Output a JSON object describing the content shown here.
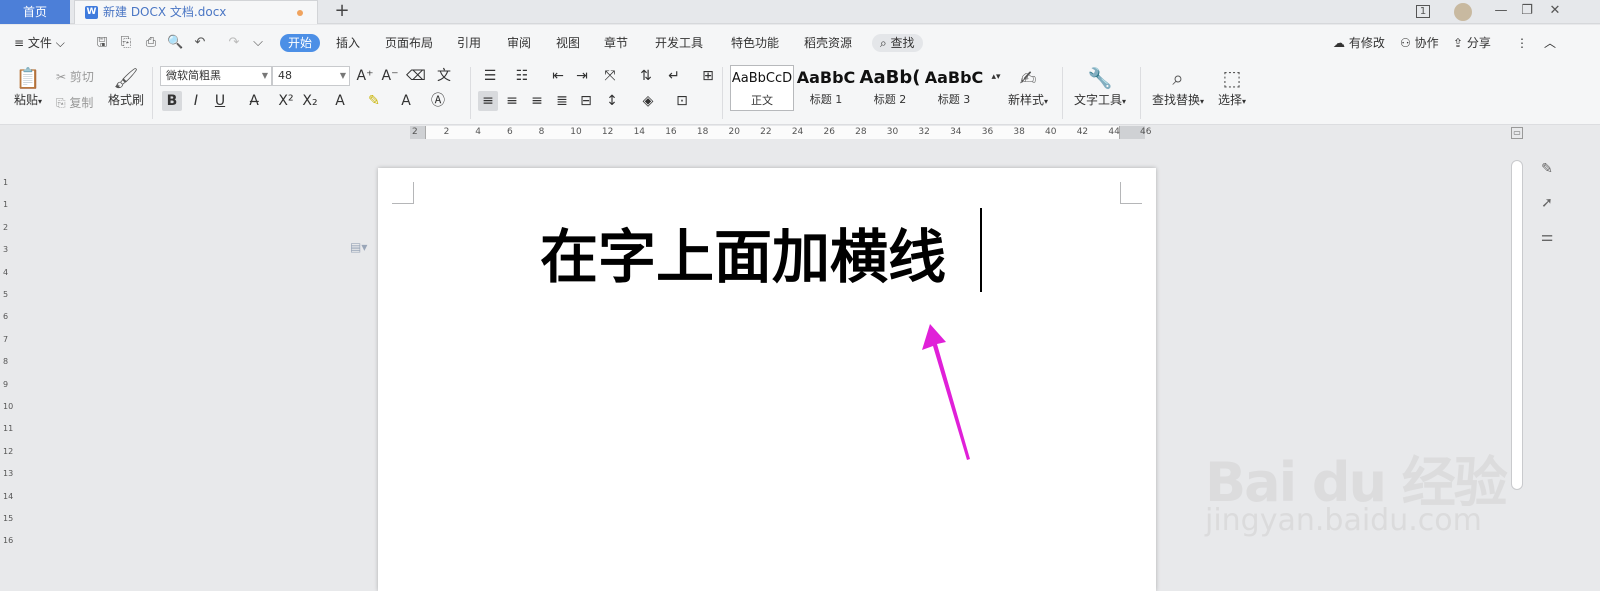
{
  "titlebar": {
    "home_tab": "首页",
    "doc_tab": "新建 DOCX 文档.docx",
    "new_tab": "+",
    "window_count": "1"
  },
  "menu": {
    "file": "文件",
    "items": [
      "开始",
      "插入",
      "页面布局",
      "引用",
      "审阅",
      "视图",
      "章节",
      "开发工具",
      "特色功能",
      "稻壳资源"
    ],
    "active": "开始",
    "search": "查找",
    "has_changes": "有修改",
    "collab": "协作",
    "share": "分享"
  },
  "ribbon": {
    "paste": "粘贴",
    "cut": "剪切",
    "copy": "复制",
    "format_painter": "格式刷",
    "font_name": "微软简粗黑",
    "font_size": "48",
    "styles": [
      {
        "preview": "AaBbCcD",
        "label": "正文"
      },
      {
        "preview": "AaBbC",
        "label": "标题 1"
      },
      {
        "preview": "AaBb(",
        "label": "标题 2"
      },
      {
        "preview": "AaBbC",
        "label": "标题 3"
      }
    ],
    "new_style": "新样式",
    "text_tools": "文字工具",
    "find_replace": "查找替换",
    "select": "选择"
  },
  "ruler": {
    "h_ticks": [
      "2",
      "2",
      "4",
      "6",
      "8",
      "10",
      "12",
      "14",
      "16",
      "18",
      "20",
      "22",
      "24",
      "26",
      "28",
      "30",
      "32",
      "34",
      "36",
      "38",
      "40",
      "42",
      "44",
      "46"
    ],
    "v_ticks": [
      "1",
      "1",
      "2",
      "3",
      "4",
      "5",
      "6",
      "7",
      "8",
      "9",
      "10",
      "11",
      "12",
      "13",
      "14",
      "15",
      "16"
    ]
  },
  "document": {
    "text": "在字上面加横线"
  },
  "watermark": {
    "logo": "Bai du 经验",
    "url": "jingyan.baidu.com"
  },
  "colors": {
    "accent": "#4c8fe6",
    "arrow": "#e020d8"
  }
}
